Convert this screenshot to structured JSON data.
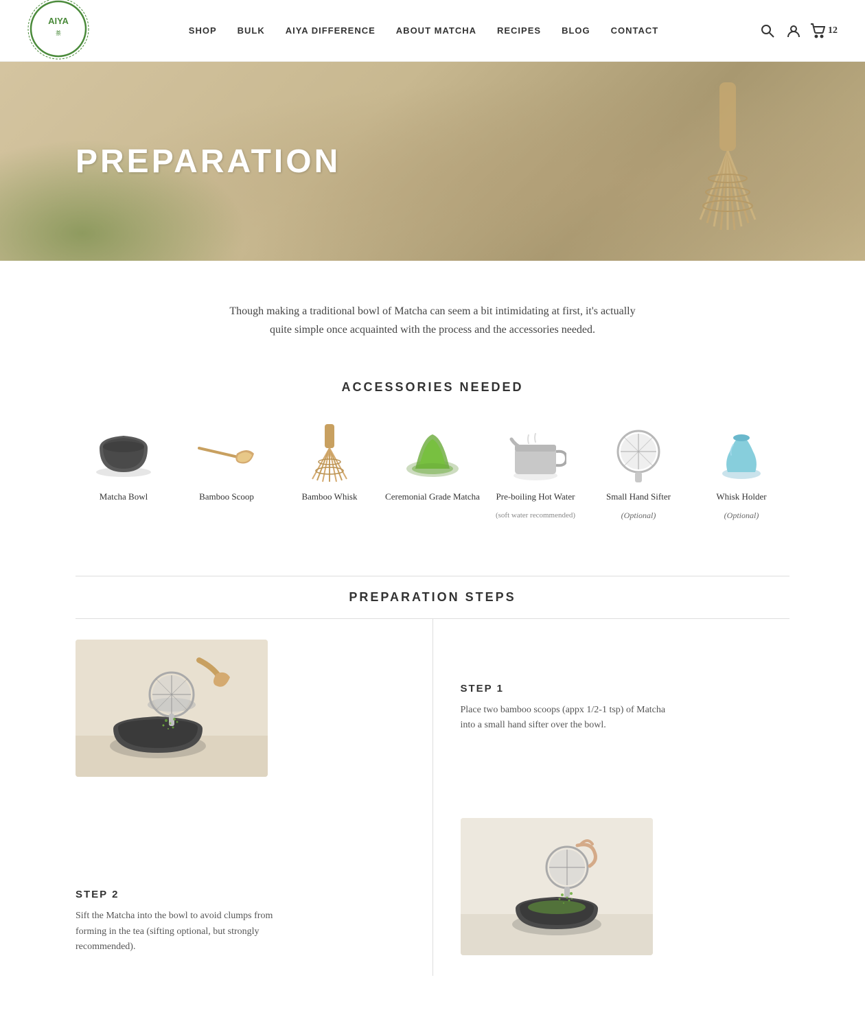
{
  "nav": {
    "logo_alt": "Aiya",
    "links": [
      {
        "id": "shop",
        "label": "SHOP"
      },
      {
        "id": "bulk",
        "label": "BULK"
      },
      {
        "id": "aiya-difference",
        "label": "AIYA DIFFERENCE"
      },
      {
        "id": "about-matcha",
        "label": "ABOUT MATCHA"
      },
      {
        "id": "recipes",
        "label": "RECIPES"
      },
      {
        "id": "blog",
        "label": "BLOG"
      },
      {
        "id": "contact",
        "label": "CONTACT"
      }
    ],
    "cart_count": "12"
  },
  "hero": {
    "title": "PREPARATION"
  },
  "intro": {
    "text": "Though making a traditional bowl of Matcha can seem a bit intimidating at first, it's actually quite simple once acquainted with the process and the accessories needed."
  },
  "accessories": {
    "section_title": "ACCESSORIES NEEDED",
    "items": [
      {
        "id": "matcha-bowl",
        "name": "Matcha Bowl",
        "optional": false,
        "note": ""
      },
      {
        "id": "bamboo-scoop",
        "name": "Bamboo Scoop",
        "optional": false,
        "note": ""
      },
      {
        "id": "bamboo-whisk",
        "name": "Bamboo Whisk",
        "optional": false,
        "note": ""
      },
      {
        "id": "ceremonial-matcha",
        "name": "Ceremonial Grade Matcha",
        "optional": false,
        "note": ""
      },
      {
        "id": "hot-water",
        "name": "Pre-boiling Hot Water",
        "optional": false,
        "note": "(soft water recommended)"
      },
      {
        "id": "hand-sifter",
        "name": "Small Hand Sifter",
        "optional": true,
        "note": ""
      },
      {
        "id": "whisk-holder",
        "name": "Whisk Holder",
        "optional": true,
        "note": ""
      }
    ]
  },
  "preparation_steps": {
    "section_title": "PREPARATION STEPS",
    "steps": [
      {
        "number": "STEP 1",
        "description": "Place two bamboo scoops (appx 1/2-1 tsp) of Matcha into a small hand sifter over the bowl."
      },
      {
        "number": "STEP 2",
        "description": "Sift the Matcha into the bowl to avoid clumps from forming in the tea (sifting optional, but strongly recommended)."
      }
    ]
  }
}
